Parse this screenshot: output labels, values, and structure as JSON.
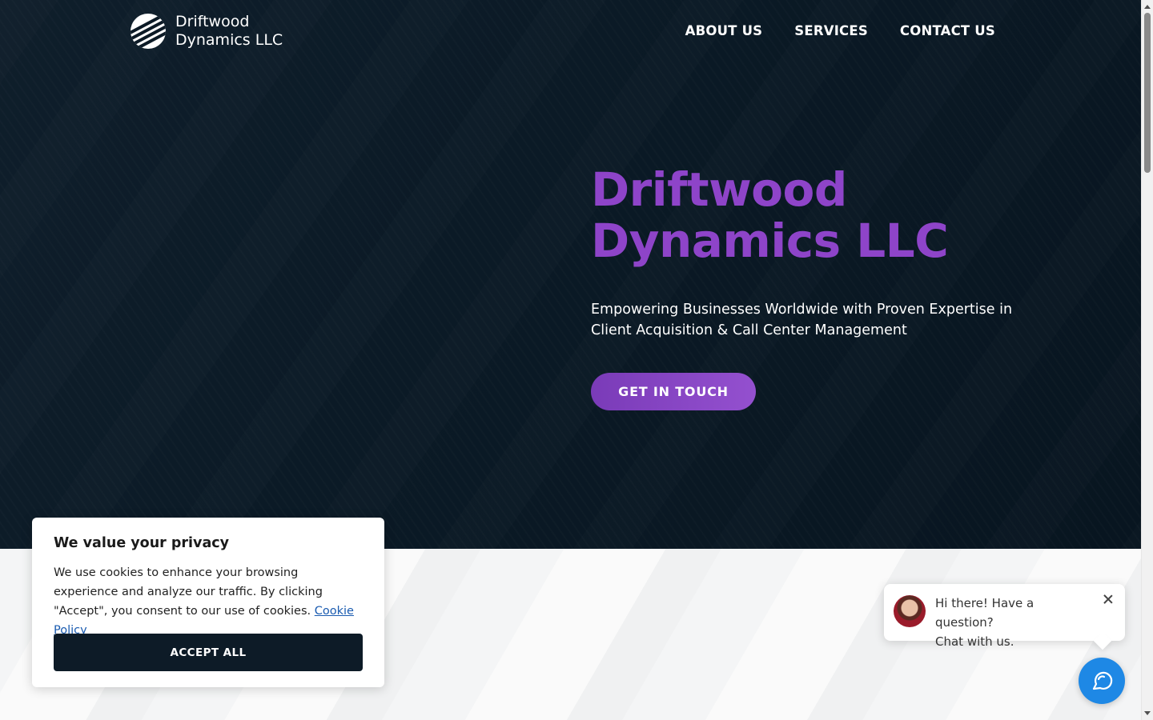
{
  "brand": {
    "name_line1": "Driftwood",
    "name_line2": "Dynamics LLC"
  },
  "nav": {
    "items": [
      {
        "label": "ABOUT US"
      },
      {
        "label": "SERVICES"
      },
      {
        "label": "CONTACT US"
      }
    ]
  },
  "hero": {
    "title_line1": "Driftwood",
    "title_line2": "Dynamics LLC",
    "subtitle_line1": "Empowering Businesses Worldwide with Proven Expertise in",
    "subtitle_line2": "Client Acquisition & Call Center Management",
    "cta_label": "GET IN TOUCH"
  },
  "cookie_banner": {
    "title": "We value your privacy",
    "text": "We use cookies to enhance your browsing experience and analyze our traffic. By clicking \"Accept\", you consent to our use of cookies.",
    "link_label": "Cookie Policy",
    "accept_label": "ACCEPT ALL"
  },
  "chat": {
    "greeting_line1": "Hi there! Have a question?",
    "greeting_line2": "Chat with us."
  },
  "colors": {
    "accent": "#8e44c9",
    "hero_bg": "#0b1a26",
    "chat_blue": "#1e88e5",
    "dark_button": "#0d1b27"
  }
}
